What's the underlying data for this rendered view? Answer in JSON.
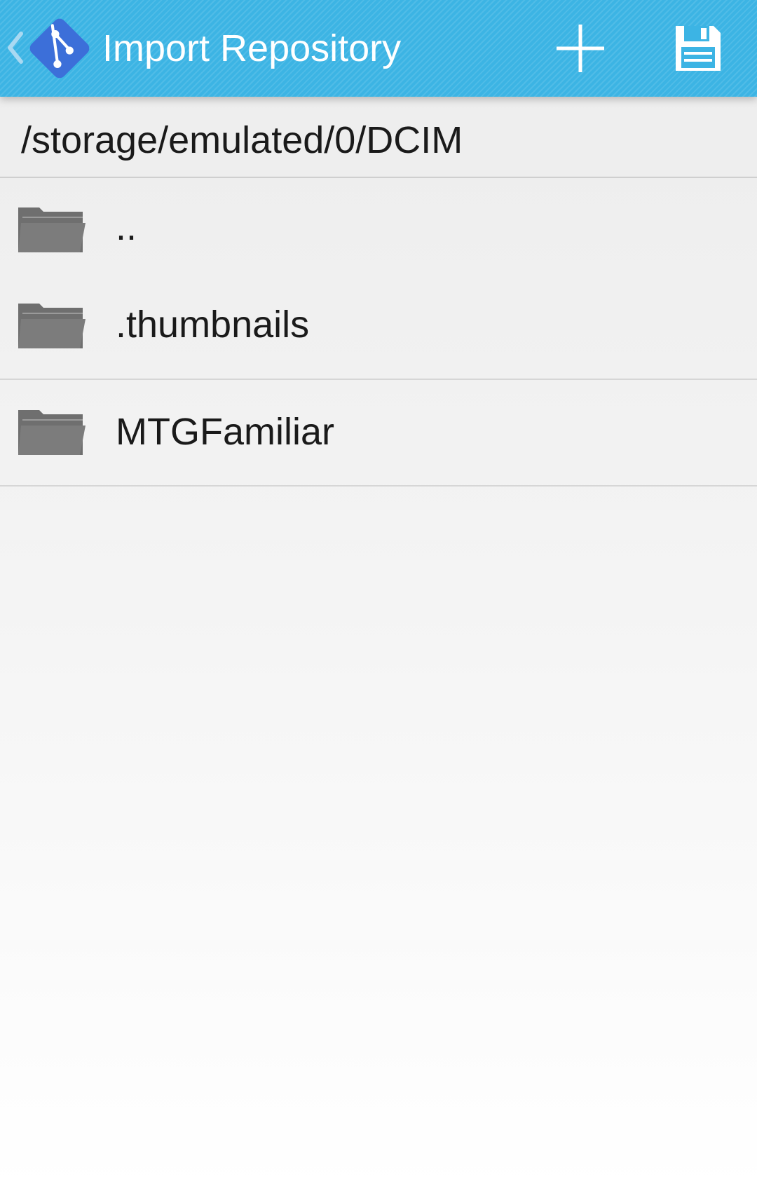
{
  "action_bar": {
    "title": "Import Repository",
    "up_icon": "chevron-left-icon",
    "logo_icon": "git-logo-icon",
    "add_icon": "plus-icon",
    "save_icon": "floppy-disk-icon",
    "background_color": "#3cb4e4",
    "logo_color": "#3c6fd9"
  },
  "current_path": "/storage/emulated/0/DCIM",
  "entries": [
    {
      "name": "..",
      "icon": "folder-icon"
    },
    {
      "name": ".thumbnails",
      "icon": "folder-icon"
    },
    {
      "name": "MTGFamiliar",
      "icon": "folder-icon"
    }
  ]
}
